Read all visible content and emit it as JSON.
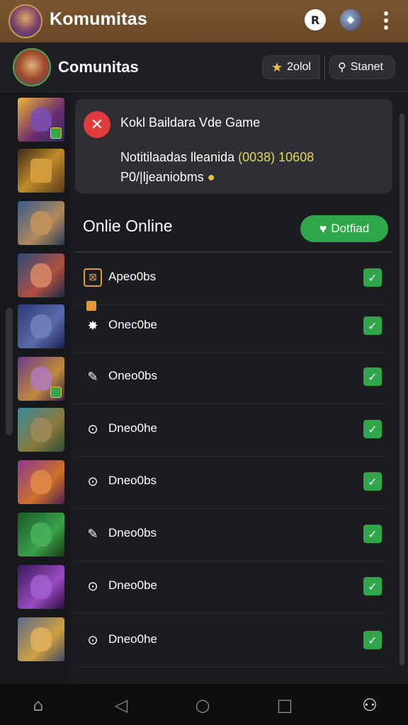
{
  "topbar": {
    "title": "Komumitas"
  },
  "header": {
    "title": "Comunitas",
    "btn_star_label": "2olol",
    "btn_right_label": "Stanet"
  },
  "notification": {
    "title": "Kokl Baildara Vde Game",
    "body_prefix": "Notitilaadas lleanida",
    "body_highlight": "(0038) 10608",
    "body_line2": "P0/|ljeaniobms"
  },
  "online": {
    "title": "Onlie Online",
    "button_label": "Dotfiad"
  },
  "list": [
    {
      "label": "Apeo0bs",
      "checked": true
    },
    {
      "label": "Onec0be",
      "checked": true
    },
    {
      "label": "Oneo0bs",
      "checked": true
    },
    {
      "label": "Dneo0he",
      "checked": true
    },
    {
      "label": "Dneo0bs",
      "checked": true
    },
    {
      "label": "Dneo0bs",
      "checked": true
    },
    {
      "label": "Dneo0be",
      "checked": true
    },
    {
      "label": "Dneo0he",
      "checked": true
    }
  ],
  "colors": {
    "topbar": "#7a5530",
    "accent_green": "#2fa64a",
    "error_red": "#e23b3b",
    "highlight": "#e6d65a"
  }
}
